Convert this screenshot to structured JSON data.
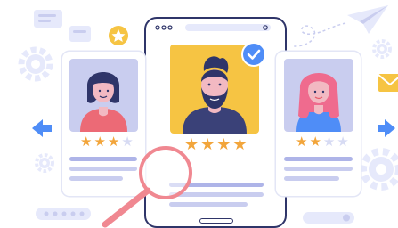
{
  "palette": {
    "navy": "#2f3569",
    "accent_blue": "#4f8df7",
    "light_lavender": "#e6e9fb",
    "line_lavender": "#c9cdef",
    "yellow": "#f6c443",
    "orange": "#f2a53b",
    "pink": "#f2b9c2",
    "red_shirt": "#e75b68",
    "magnifier_pink": "#f08891"
  },
  "profiles": [
    {
      "id": "left",
      "rating": 3,
      "max_rating": 4,
      "avatar_bg": "#c9cdef",
      "shirt": "#ec6a76",
      "hair": "#2f3569"
    },
    {
      "id": "center",
      "rating": 4,
      "max_rating": 4,
      "avatar_bg": "#f6c443",
      "shirt": "#3a4178",
      "hair": "#2f3569",
      "verified": true
    },
    {
      "id": "right",
      "rating": 2,
      "max_rating": 4,
      "avatar_bg": "#c9cdef",
      "shirt": "#4f8df7",
      "hair": "#ef6b8e"
    }
  ],
  "icons": {
    "badge": "star-badge-icon",
    "verified": "checkmark-badge-icon",
    "search": "magnifying-glass-icon",
    "left_nav": "arrow-left-icon",
    "right_nav": "arrow-right-icon",
    "send": "paper-plane-icon",
    "mail": "envelope-icon",
    "settings": "gear-icon",
    "chat": "chat-bubble-icon"
  }
}
